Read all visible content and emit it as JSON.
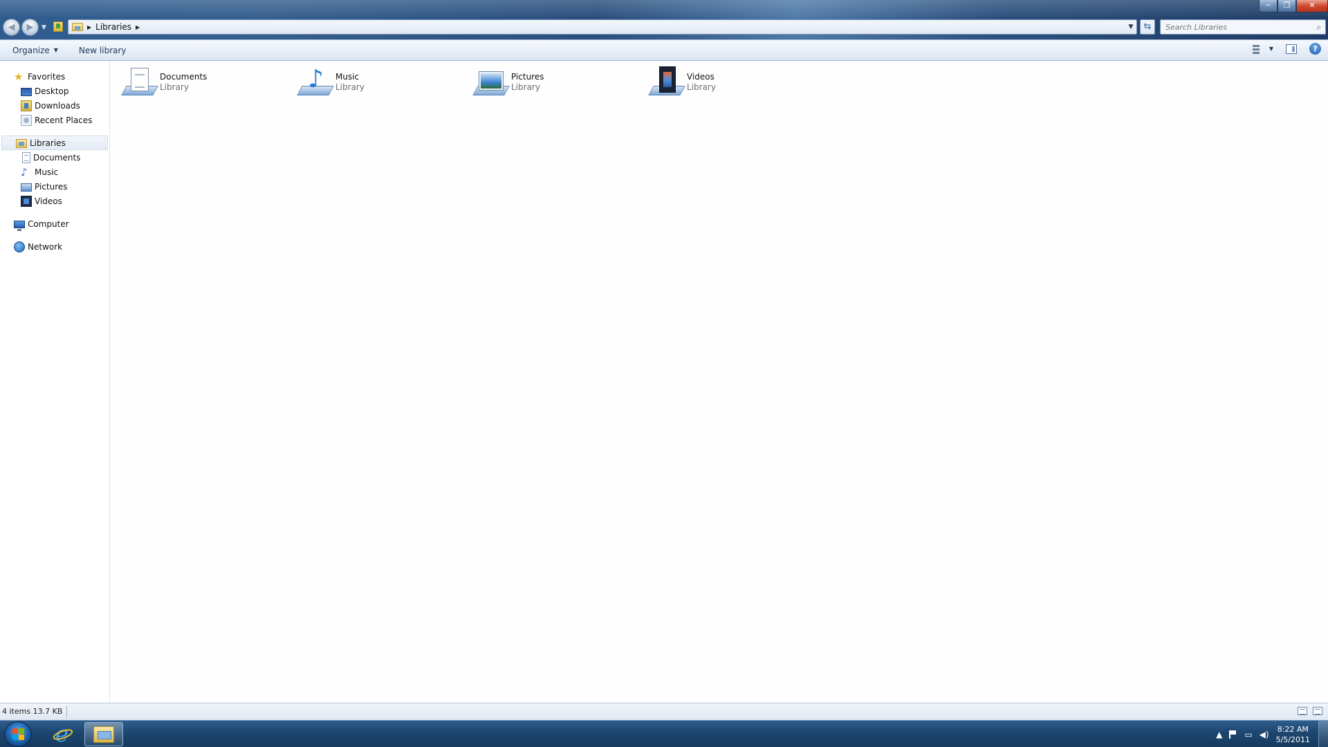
{
  "window": {
    "controls": {
      "minimize": "─",
      "maximize": "❐",
      "close": "✕"
    }
  },
  "address": {
    "breadcrumbs": [
      "Libraries"
    ],
    "search_placeholder": "Search Libraries"
  },
  "toolbar": {
    "organize_label": "Organize",
    "new_library_label": "New library"
  },
  "nav": {
    "favorites": {
      "label": "Favorites",
      "items": [
        {
          "label": "Desktop",
          "icon": "desktop-icon"
        },
        {
          "label": "Downloads",
          "icon": "downloads-icon"
        },
        {
          "label": "Recent Places",
          "icon": "recent-places-icon"
        }
      ]
    },
    "libraries": {
      "label": "Libraries",
      "items": [
        {
          "label": "Documents",
          "icon": "documents-icon"
        },
        {
          "label": "Music",
          "icon": "music-icon"
        },
        {
          "label": "Pictures",
          "icon": "pictures-icon"
        },
        {
          "label": "Videos",
          "icon": "videos-icon"
        }
      ]
    },
    "computer": {
      "label": "Computer"
    },
    "network": {
      "label": "Network"
    }
  },
  "libraries": [
    {
      "name": "Documents",
      "type": "Library",
      "icon": "documents-library-icon"
    },
    {
      "name": "Music",
      "type": "Library",
      "icon": "music-library-icon"
    },
    {
      "name": "Pictures",
      "type": "Library",
      "icon": "pictures-library-icon"
    },
    {
      "name": "Videos",
      "type": "Library",
      "icon": "videos-library-icon"
    }
  ],
  "status": {
    "summary": "4 items 13.7 KB"
  },
  "taskbar": {
    "clock_time": "8:22 AM",
    "clock_date": "5/5/2011"
  },
  "colors": {
    "glass": "#2f5c8f",
    "taskbar": "#1d466f",
    "command_text": "#1e395b",
    "secondary_text": "#6d6d6d"
  }
}
